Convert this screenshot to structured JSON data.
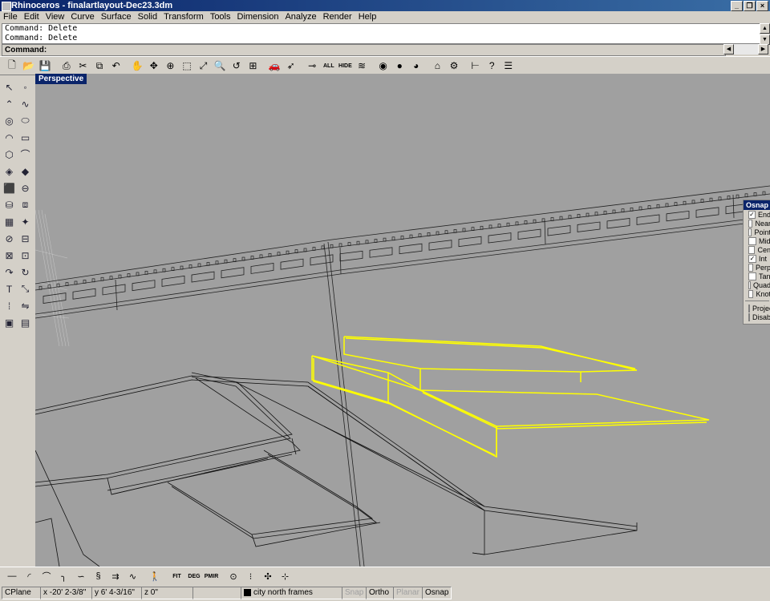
{
  "window": {
    "title": "Rhinoceros - finalartlayout-Dec23.3dm",
    "min": "_",
    "max": "❐",
    "close": "×"
  },
  "menu": [
    "File",
    "Edit",
    "View",
    "Curve",
    "Surface",
    "Solid",
    "Transform",
    "Tools",
    "Dimension",
    "Analyze",
    "Render",
    "Help"
  ],
  "command_history": [
    "Command: Delete",
    "Command: Delete"
  ],
  "command_prompt": "Command:",
  "toolbar_icons": [
    {
      "name": "new-icon",
      "glyph": "🗋"
    },
    {
      "name": "open-icon",
      "glyph": "📂"
    },
    {
      "name": "save-icon",
      "glyph": "💾"
    },
    {
      "name": "print-icon",
      "glyph": "⎙"
    },
    {
      "name": "cut-icon",
      "glyph": "✂"
    },
    {
      "name": "copy-icon",
      "glyph": "⧉"
    },
    {
      "name": "undo-icon",
      "glyph": "↶"
    },
    {
      "name": "pan-icon",
      "glyph": "✋"
    },
    {
      "name": "rotate-view-icon",
      "glyph": "✥"
    },
    {
      "name": "zoom-icon",
      "glyph": "⊕"
    },
    {
      "name": "zoom-window-icon",
      "glyph": "⬚"
    },
    {
      "name": "zoom-extents-icon",
      "glyph": "⤢"
    },
    {
      "name": "zoom-selected-icon",
      "glyph": "🔍"
    },
    {
      "name": "undo-view-icon",
      "glyph": "↺"
    },
    {
      "name": "four-views-icon",
      "glyph": "⊞"
    },
    {
      "name": "car-icon",
      "glyph": "🚗"
    },
    {
      "name": "select-icon",
      "glyph": "➶"
    },
    {
      "name": "show-icon",
      "glyph": "⊸"
    },
    {
      "name": "show-all-icon",
      "glyph": "ALL"
    },
    {
      "name": "hide-icon",
      "glyph": "HIDE"
    },
    {
      "name": "layers-icon",
      "glyph": "≋"
    },
    {
      "name": "color-wheel-icon",
      "glyph": "◉"
    },
    {
      "name": "shade-icon",
      "glyph": "●"
    },
    {
      "name": "render-icon",
      "glyph": "◕"
    },
    {
      "name": "light-icon",
      "glyph": "⌂"
    },
    {
      "name": "gear-icon",
      "glyph": "⚙"
    },
    {
      "name": "dimension-icon",
      "glyph": "⊢"
    },
    {
      "name": "help-icon",
      "glyph": "?"
    },
    {
      "name": "properties-icon",
      "glyph": "☰"
    }
  ],
  "left_toolbar_icons": [
    {
      "name": "select-arrow-icon",
      "glyph": "↖"
    },
    {
      "name": "point-icon",
      "glyph": "◦"
    },
    {
      "name": "polyline-icon",
      "glyph": "⌃"
    },
    {
      "name": "curve-icon",
      "glyph": "∿"
    },
    {
      "name": "circle-icon",
      "glyph": "◎"
    },
    {
      "name": "ellipse-icon",
      "glyph": "⬭"
    },
    {
      "name": "arc-icon",
      "glyph": "◠"
    },
    {
      "name": "rectangle-icon",
      "glyph": "▭"
    },
    {
      "name": "polygon-icon",
      "glyph": "⬡"
    },
    {
      "name": "fillet-icon",
      "glyph": "⌒"
    },
    {
      "name": "surface-icon",
      "glyph": "◈"
    },
    {
      "name": "surface-patch-icon",
      "glyph": "◆"
    },
    {
      "name": "box-icon",
      "glyph": "⬛"
    },
    {
      "name": "boolean-icon",
      "glyph": "⊖"
    },
    {
      "name": "cylinder-icon",
      "glyph": "⛁"
    },
    {
      "name": "extrude-icon",
      "glyph": "⧈"
    },
    {
      "name": "mesh-icon",
      "glyph": "▦"
    },
    {
      "name": "explode-icon",
      "glyph": "✦"
    },
    {
      "name": "split-icon",
      "glyph": "⊘"
    },
    {
      "name": "trim-icon",
      "glyph": "⊟"
    },
    {
      "name": "join-icon",
      "glyph": "⊠"
    },
    {
      "name": "group-icon",
      "glyph": "⊡"
    },
    {
      "name": "move-icon",
      "glyph": "↷"
    },
    {
      "name": "rotate-icon",
      "glyph": "↻"
    },
    {
      "name": "text-icon",
      "glyph": "T"
    },
    {
      "name": "scale-icon",
      "glyph": "⤡"
    },
    {
      "name": "array-icon",
      "glyph": "⁞"
    },
    {
      "name": "mirror-icon",
      "glyph": "⇋"
    },
    {
      "name": "layout-icon",
      "glyph": "▣"
    },
    {
      "name": "grid-icon",
      "glyph": "▤"
    }
  ],
  "viewport": {
    "label": "Perspective"
  },
  "osnap": {
    "title": "Osnap",
    "items": [
      {
        "label": "End",
        "checked": true
      },
      {
        "label": "Near",
        "checked": false
      },
      {
        "label": "Point",
        "checked": false
      },
      {
        "label": "Mid",
        "checked": false
      },
      {
        "label": "Cen",
        "checked": false
      },
      {
        "label": "Int",
        "checked": true
      },
      {
        "label": "Perp",
        "checked": false
      },
      {
        "label": "Tan",
        "checked": false
      },
      {
        "label": "Quad",
        "checked": false
      },
      {
        "label": "Knot",
        "checked": false
      }
    ],
    "extra": [
      {
        "label": "Project",
        "checked": false
      },
      {
        "label": "Disable",
        "checked": false
      }
    ]
  },
  "bottom_toolbar_icons": [
    {
      "name": "line-icon",
      "glyph": "—"
    },
    {
      "name": "arc-tool-icon",
      "glyph": "◜"
    },
    {
      "name": "curve-tool-icon",
      "glyph": "⌒"
    },
    {
      "name": "fillet-tool-icon",
      "glyph": "╮"
    },
    {
      "name": "freeform-icon",
      "glyph": "∽"
    },
    {
      "name": "helix-icon",
      "glyph": "§"
    },
    {
      "name": "offset-icon",
      "glyph": "⇉"
    },
    {
      "name": "blend-icon",
      "glyph": "∿"
    },
    {
      "name": "person-icon",
      "glyph": "🚶"
    },
    {
      "name": "fit-icon",
      "glyph": "FIT"
    },
    {
      "name": "degree-icon",
      "glyph": "DEG"
    },
    {
      "name": "pmirror-icon",
      "glyph": "PMIR"
    },
    {
      "name": "zoom-tool-icon",
      "glyph": "⊙"
    },
    {
      "name": "points-on-icon",
      "glyph": "⁝"
    },
    {
      "name": "snap-points-icon",
      "glyph": "✣"
    },
    {
      "name": "control-points-icon",
      "glyph": "⊹"
    }
  ],
  "status": {
    "cplane": "CPlane",
    "x": "x -20' 2-3/8\"",
    "y": "y 6' 4-3/16\"",
    "z": "z 0\"",
    "layer": "city north frames",
    "snap": "Snap",
    "ortho": "Ortho",
    "planar": "Planar",
    "osnap": "Osnap"
  },
  "colors": {
    "accent": "#0a246a",
    "selection": "#ffff00",
    "viewport_bg": "#a0a0a0",
    "wire": "#000000"
  }
}
